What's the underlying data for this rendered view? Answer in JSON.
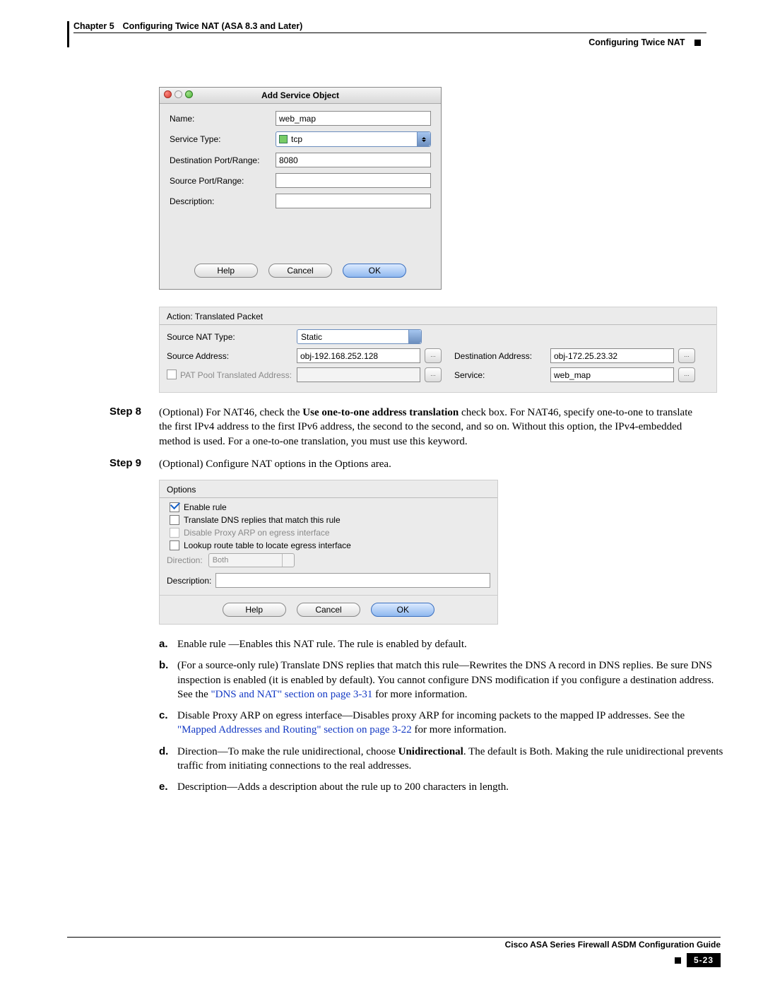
{
  "header": {
    "chapter": "Chapter 5",
    "title": "Configuring Twice NAT (ASA 8.3 and Later)",
    "section": "Configuring Twice NAT"
  },
  "dialog1": {
    "title": "Add Service Object",
    "labels": {
      "name": "Name:",
      "serviceType": "Service Type:",
      "destPort": "Destination Port/Range:",
      "srcPort": "Source Port/Range:",
      "description": "Description:"
    },
    "values": {
      "name": "web_map",
      "serviceType": "tcp",
      "destPort": "8080",
      "srcPort": "",
      "description": ""
    },
    "buttons": {
      "help": "Help",
      "cancel": "Cancel",
      "ok": "OK"
    }
  },
  "panel2": {
    "title": "Action: Translated Packet",
    "labels": {
      "sourceNat": "Source NAT Type:",
      "srcAddr": "Source Address:",
      "patPool": "PAT Pool Translated Address:",
      "dstAddr": "Destination Address:",
      "service": "Service:"
    },
    "values": {
      "sourceNat": "Static",
      "srcAddr": "obj-192.168.252.128",
      "patPool": "",
      "dstAddr": "obj-172.25.23.32",
      "service": "web_map"
    },
    "pickbtn": "..."
  },
  "steps": {
    "s8_label": "Step 8",
    "s8_text_a": "(Optional) For NAT46, check the ",
    "s8_text_b_bold": "Use one-to-one address translation",
    "s8_text_c": " check box. For NAT46, specify one-to-one to translate the first IPv4 address to the first IPv6 address, the second to the second, and so on. Without this option, the IPv4-embedded method is used. For a one-to-one translation, you must use this keyword.",
    "s9_label": "Step 9",
    "s9_text": "(Optional) Configure NAT options in the Options area."
  },
  "dialog3": {
    "title": "Options",
    "items": {
      "enable": "Enable rule",
      "dns": "Translate DNS replies that match this rule",
      "proxy": "Disable Proxy ARP on egress interface",
      "lookup": "Lookup route table to locate egress interface"
    },
    "direction_label": "Direction:",
    "direction_value": "Both",
    "description_label": "Description:",
    "description_value": "",
    "buttons": {
      "help": "Help",
      "cancel": "Cancel",
      "ok": "OK"
    }
  },
  "letters": {
    "a": "Enable rule —Enables this NAT rule. The rule is enabled by default.",
    "b_pre": "(For a source-only rule) Translate DNS replies that match this rule—Rewrites the DNS A record in DNS replies. Be sure DNS inspection is enabled (it is enabled by default). You cannot configure DNS modification if you configure a destination address. See the ",
    "b_link": "\"DNS and NAT\" section on page 3-31",
    "b_post": " for more information.",
    "c_pre": "Disable Proxy ARP on egress interface—Disables proxy ARP for incoming packets to the mapped IP addresses. See the ",
    "c_link": "\"Mapped Addresses and Routing\" section on page 3-22",
    "c_post": " for more information.",
    "d_pre": "Direction—To make the rule unidirectional, choose ",
    "d_bold": "Unidirectional",
    "d_post": ". The default is Both. Making the rule unidirectional prevents traffic from initiating connections to the real addresses.",
    "e": "Description—Adds a description about the rule up to 200 characters in length."
  },
  "footer": {
    "guide": "Cisco ASA Series Firewall ASDM Configuration Guide",
    "page": "5-23"
  }
}
